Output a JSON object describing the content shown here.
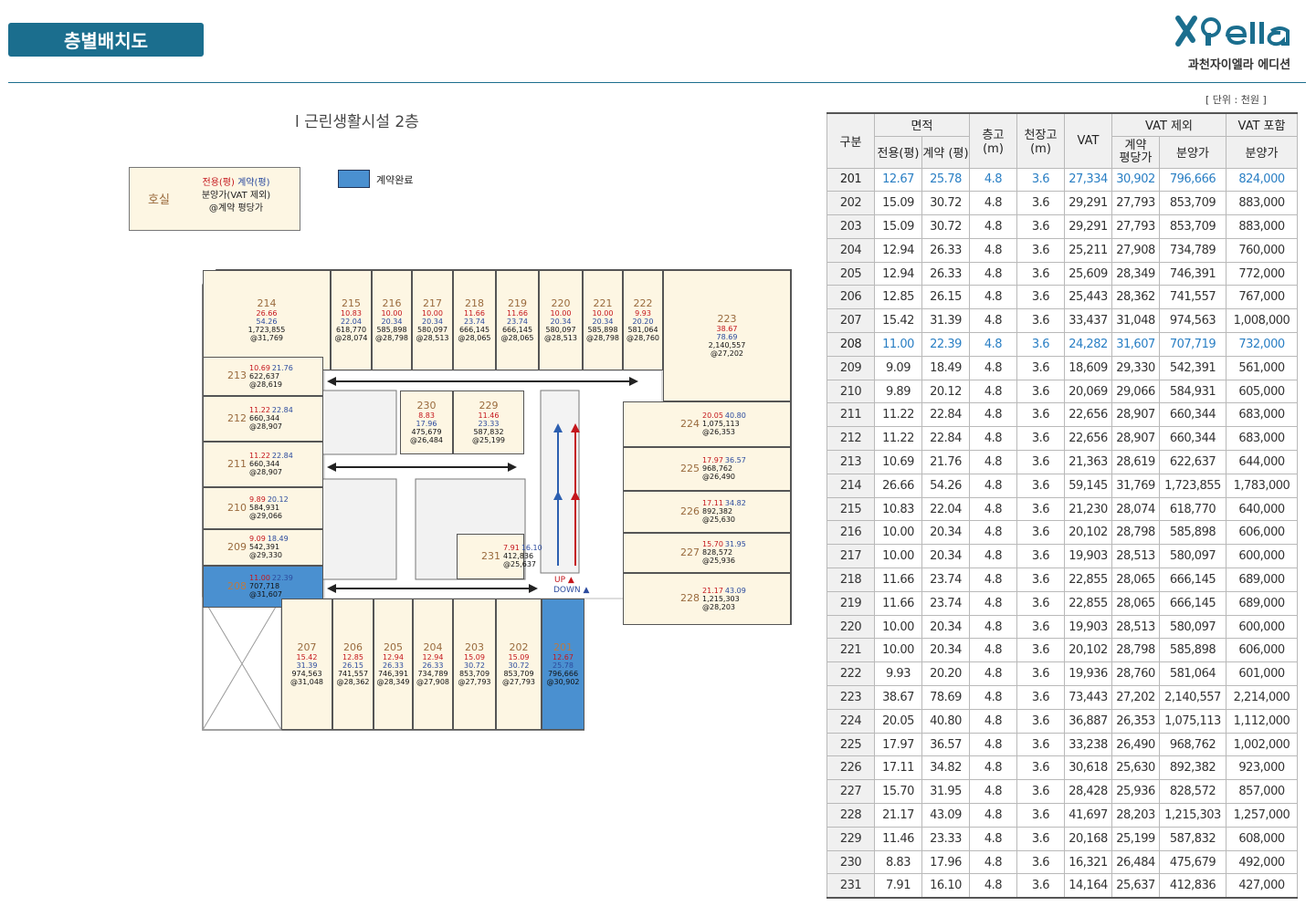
{
  "header": {
    "title": "층별배치도",
    "logo_text": "Xi ella",
    "logo_sub": "과천자이엘라 에디션",
    "unit": "[ 단위 : 천원 ]"
  },
  "plan": {
    "title": "l 근린생활시설 2층",
    "legend": {
      "room_label": "호실",
      "line1_red": "전용(평)",
      "line1_blue": "계약(평)",
      "line2": "분양가(VAT 제외)",
      "line3": "@계약 평당가"
    },
    "done_label": "계약완료",
    "up_label": "UP ▲",
    "down_label": "DOWN ▲",
    "units": [
      {
        "no": "214",
        "ex": "26.66",
        "ct": "54.26",
        "price": "1,723,855",
        "pp": "@31,769"
      },
      {
        "no": "215",
        "ex": "10.83",
        "ct": "22.04",
        "price": "618,770",
        "pp": "@28,074"
      },
      {
        "no": "216",
        "ex": "10.00",
        "ct": "20.34",
        "price": "585,898",
        "pp": "@28,798"
      },
      {
        "no": "217",
        "ex": "10.00",
        "ct": "20.34",
        "price": "580,097",
        "pp": "@28,513"
      },
      {
        "no": "218",
        "ex": "11.66",
        "ct": "23.74",
        "price": "666,145",
        "pp": "@28,065"
      },
      {
        "no": "219",
        "ex": "11.66",
        "ct": "23.74",
        "price": "666,145",
        "pp": "@28,065"
      },
      {
        "no": "220",
        "ex": "10.00",
        "ct": "20.34",
        "price": "580,097",
        "pp": "@28,513"
      },
      {
        "no": "221",
        "ex": "10.00",
        "ct": "20.34",
        "price": "585,898",
        "pp": "@28,798"
      },
      {
        "no": "222",
        "ex": "9.93",
        "ct": "20.20",
        "price": "581,064",
        "pp": "@28,760"
      },
      {
        "no": "223",
        "ex": "38.67",
        "ct": "78.69",
        "price": "2,140,557",
        "pp": "@27,202"
      },
      {
        "no": "213",
        "ex": "10.69",
        "ct": "21.76",
        "price": "622,637",
        "pp": "@28,619"
      },
      {
        "no": "212",
        "ex": "11.22",
        "ct": "22.84",
        "price": "660,344",
        "pp": "@28,907"
      },
      {
        "no": "211",
        "ex": "11.22",
        "ct": "22.84",
        "price": "660,344",
        "pp": "@28,907"
      },
      {
        "no": "210",
        "ex": "9.89",
        "ct": "20.12",
        "price": "584,931",
        "pp": "@29,066"
      },
      {
        "no": "209",
        "ex": "9.09",
        "ct": "18.49",
        "price": "542,391",
        "pp": "@29,330"
      },
      {
        "no": "208",
        "ex": "11.00",
        "ct": "22.39",
        "price": "707,718",
        "pp": "@31,607"
      },
      {
        "no": "230",
        "ex": "8.83",
        "ct": "17.96",
        "price": "475,679",
        "pp": "@26,484"
      },
      {
        "no": "229",
        "ex": "11.46",
        "ct": "23.33",
        "price": "587,832",
        "pp": "@25,199"
      },
      {
        "no": "231",
        "ex": "7.91",
        "ct": "16.10",
        "price": "412,836",
        "pp": "@25,637"
      },
      {
        "no": "224",
        "ex": "20.05",
        "ct": "40.80",
        "price": "1,075,113",
        "pp": "@26,353"
      },
      {
        "no": "225",
        "ex": "17.97",
        "ct": "36.57",
        "price": "968,762",
        "pp": "@26,490"
      },
      {
        "no": "226",
        "ex": "17.11",
        "ct": "34.82",
        "price": "892,382",
        "pp": "@25,630"
      },
      {
        "no": "227",
        "ex": "15.70",
        "ct": "31.95",
        "price": "828,572",
        "pp": "@25,936"
      },
      {
        "no": "228",
        "ex": "21.17",
        "ct": "43.09",
        "price": "1,215,303",
        "pp": "@28,203"
      },
      {
        "no": "207",
        "ex": "15.42",
        "ct": "31.39",
        "price": "974,563",
        "pp": "@31,048"
      },
      {
        "no": "206",
        "ex": "12.85",
        "ct": "26.15",
        "price": "741,557",
        "pp": "@28,362"
      },
      {
        "no": "205",
        "ex": "12.94",
        "ct": "26.33",
        "price": "746,391",
        "pp": "@28,349"
      },
      {
        "no": "204",
        "ex": "12.94",
        "ct": "26.33",
        "price": "734,789",
        "pp": "@27,908"
      },
      {
        "no": "203",
        "ex": "15.09",
        "ct": "30.72",
        "price": "853,709",
        "pp": "@27,793"
      },
      {
        "no": "202",
        "ex": "15.09",
        "ct": "30.72",
        "price": "853,709",
        "pp": "@27,793"
      },
      {
        "no": "201",
        "ex": "12.67",
        "ct": "25.78",
        "price": "796,666",
        "pp": "@30,902"
      }
    ]
  },
  "table": {
    "h_gubun": "구분",
    "h_area": "면적",
    "h_floor_h": "층고",
    "h_floor_h_unit": "(m)",
    "h_ceil_h": "천장고",
    "h_ceil_h_unit": "(m)",
    "h_vat": "VAT",
    "h_vat_ex": "VAT 제외",
    "h_vat_in": "VAT 포함",
    "h_excl": "전용(평)",
    "h_contract": "계약 (평)",
    "h_contract_pp_1": "계약",
    "h_contract_pp_2": "평당가",
    "h_price": "분양가",
    "h_price2": "분양가",
    "rows": [
      [
        "201",
        "12.67",
        "25.78",
        "4.8",
        "3.6",
        "27,334",
        "30,902",
        "796,666",
        "824,000"
      ],
      [
        "202",
        "15.09",
        "30.72",
        "4.8",
        "3.6",
        "29,291",
        "27,793",
        "853,709",
        "883,000"
      ],
      [
        "203",
        "15.09",
        "30.72",
        "4.8",
        "3.6",
        "29,291",
        "27,793",
        "853,709",
        "883,000"
      ],
      [
        "204",
        "12.94",
        "26.33",
        "4.8",
        "3.6",
        "25,211",
        "27,908",
        "734,789",
        "760,000"
      ],
      [
        "205",
        "12.94",
        "26.33",
        "4.8",
        "3.6",
        "25,609",
        "28,349",
        "746,391",
        "772,000"
      ],
      [
        "206",
        "12.85",
        "26.15",
        "4.8",
        "3.6",
        "25,443",
        "28,362",
        "741,557",
        "767,000"
      ],
      [
        "207",
        "15.42",
        "31.39",
        "4.8",
        "3.6",
        "33,437",
        "31,048",
        "974,563",
        "1,008,000"
      ],
      [
        "208",
        "11.00",
        "22.39",
        "4.8",
        "3.6",
        "24,282",
        "31,607",
        "707,719",
        "732,000"
      ],
      [
        "209",
        "9.09",
        "18.49",
        "4.8",
        "3.6",
        "18,609",
        "29,330",
        "542,391",
        "561,000"
      ],
      [
        "210",
        "9.89",
        "20.12",
        "4.8",
        "3.6",
        "20,069",
        "29,066",
        "584,931",
        "605,000"
      ],
      [
        "211",
        "11.22",
        "22.84",
        "4.8",
        "3.6",
        "22,656",
        "28,907",
        "660,344",
        "683,000"
      ],
      [
        "212",
        "11.22",
        "22.84",
        "4.8",
        "3.6",
        "22,656",
        "28,907",
        "660,344",
        "683,000"
      ],
      [
        "213",
        "10.69",
        "21.76",
        "4.8",
        "3.6",
        "21,363",
        "28,619",
        "622,637",
        "644,000"
      ],
      [
        "214",
        "26.66",
        "54.26",
        "4.8",
        "3.6",
        "59,145",
        "31,769",
        "1,723,855",
        "1,783,000"
      ],
      [
        "215",
        "10.83",
        "22.04",
        "4.8",
        "3.6",
        "21,230",
        "28,074",
        "618,770",
        "640,000"
      ],
      [
        "216",
        "10.00",
        "20.34",
        "4.8",
        "3.6",
        "20,102",
        "28,798",
        "585,898",
        "606,000"
      ],
      [
        "217",
        "10.00",
        "20.34",
        "4.8",
        "3.6",
        "19,903",
        "28,513",
        "580,097",
        "600,000"
      ],
      [
        "218",
        "11.66",
        "23.74",
        "4.8",
        "3.6",
        "22,855",
        "28,065",
        "666,145",
        "689,000"
      ],
      [
        "219",
        "11.66",
        "23.74",
        "4.8",
        "3.6",
        "22,855",
        "28,065",
        "666,145",
        "689,000"
      ],
      [
        "220",
        "10.00",
        "20.34",
        "4.8",
        "3.6",
        "19,903",
        "28,513",
        "580,097",
        "600,000"
      ],
      [
        "221",
        "10.00",
        "20.34",
        "4.8",
        "3.6",
        "20,102",
        "28,798",
        "585,898",
        "606,000"
      ],
      [
        "222",
        "9.93",
        "20.20",
        "4.8",
        "3.6",
        "19,936",
        "28,760",
        "581,064",
        "601,000"
      ],
      [
        "223",
        "38.67",
        "78.69",
        "4.8",
        "3.6",
        "73,443",
        "27,202",
        "2,140,557",
        "2,214,000"
      ],
      [
        "224",
        "20.05",
        "40.80",
        "4.8",
        "3.6",
        "36,887",
        "26,353",
        "1,075,113",
        "1,112,000"
      ],
      [
        "225",
        "17.97",
        "36.57",
        "4.8",
        "3.6",
        "33,238",
        "26,490",
        "968,762",
        "1,002,000"
      ],
      [
        "226",
        "17.11",
        "34.82",
        "4.8",
        "3.6",
        "30,618",
        "25,630",
        "892,382",
        "923,000"
      ],
      [
        "227",
        "15.70",
        "31.95",
        "4.8",
        "3.6",
        "28,428",
        "25,936",
        "828,572",
        "857,000"
      ],
      [
        "228",
        "21.17",
        "43.09",
        "4.8",
        "3.6",
        "41,697",
        "28,203",
        "1,215,303",
        "1,257,000"
      ],
      [
        "229",
        "11.46",
        "23.33",
        "4.8",
        "3.6",
        "20,168",
        "25,199",
        "587,832",
        "608,000"
      ],
      [
        "230",
        "8.83",
        "17.96",
        "4.8",
        "3.6",
        "16,321",
        "26,484",
        "475,679",
        "492,000"
      ],
      [
        "231",
        "7.91",
        "16.10",
        "4.8",
        "3.6",
        "14,164",
        "25,637",
        "412,836",
        "427,000"
      ]
    ],
    "sold": [
      "201",
      "208"
    ]
  }
}
